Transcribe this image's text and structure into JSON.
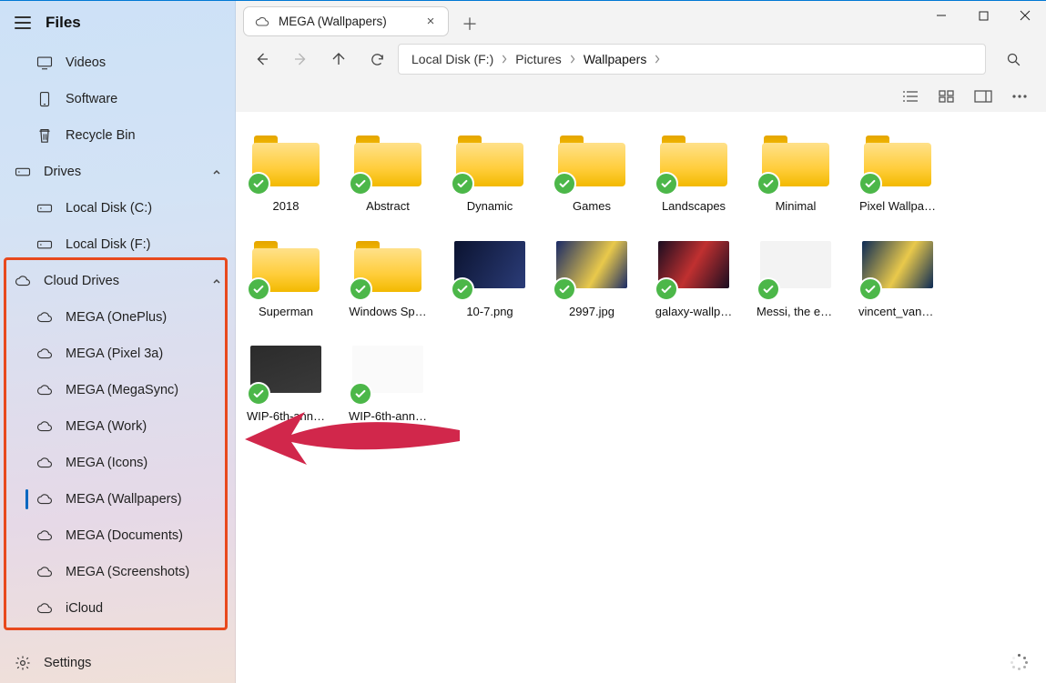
{
  "app_title": "Files",
  "sidebar": {
    "top": [
      {
        "icon": "monitor",
        "label": "Videos"
      },
      {
        "icon": "phone",
        "label": "Software"
      },
      {
        "icon": "trash",
        "label": "Recycle Bin"
      }
    ],
    "drives_header": "Drives",
    "drives": [
      {
        "label": "Local Disk (C:)"
      },
      {
        "label": "Local Disk (F:)"
      }
    ],
    "cloud_header": "Cloud Drives",
    "cloud": [
      {
        "label": "MEGA (OnePlus)"
      },
      {
        "label": "MEGA (Pixel 3a)"
      },
      {
        "label": "MEGA (MegaSync)"
      },
      {
        "label": "MEGA (Work)"
      },
      {
        "label": "MEGA (Icons)"
      },
      {
        "label": "MEGA (Wallpapers)",
        "active": true
      },
      {
        "label": "MEGA (Documents)"
      },
      {
        "label": "MEGA (Screenshots)"
      },
      {
        "label": "iCloud"
      }
    ],
    "settings": "Settings"
  },
  "tab": {
    "label": "MEGA (Wallpapers)"
  },
  "breadcrumb": [
    "Local Disk (F:)",
    "Pictures",
    "Wallpapers"
  ],
  "folders": [
    {
      "name": "2018"
    },
    {
      "name": "Abstract"
    },
    {
      "name": "Dynamic"
    },
    {
      "name": "Games"
    },
    {
      "name": "Landscapes"
    },
    {
      "name": "Minimal"
    },
    {
      "name": "Pixel Wallpa…"
    },
    {
      "name": "Superman"
    },
    {
      "name": "Windows Sp…"
    }
  ],
  "files": [
    {
      "name": "10-7.png",
      "bg": "linear-gradient(120deg,#0b1330,#2b3c78)"
    },
    {
      "name": "2997.jpg",
      "bg": "linear-gradient(120deg,#1a2a66,#e9c94b 60%,#1a2a66)"
    },
    {
      "name": "galaxy-wallp…",
      "bg": "linear-gradient(120deg,#1a0d20,#c03030 50%,#1a0d20)"
    },
    {
      "name": "Messi, the et…",
      "bg": "#f3f3f3"
    },
    {
      "name": "vincent_van_…",
      "bg": "linear-gradient(120deg,#0c2a55,#e9c94b 55%,#0c2a55)"
    },
    {
      "name": "WIP-6th-ann…",
      "bg": "linear-gradient(160deg,#2b2b2b,#3a3a3a)"
    },
    {
      "name": "WIP-6th-ann…",
      "bg": "#fafafa"
    }
  ]
}
